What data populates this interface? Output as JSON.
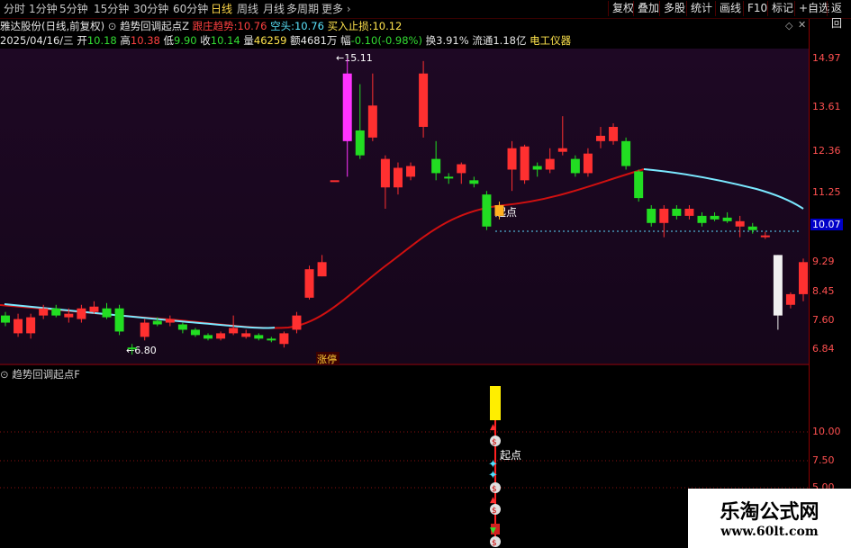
{
  "toolbar": {
    "periods": [
      "分时",
      "1分钟",
      "5分钟",
      "15分钟",
      "30分钟",
      "60分钟",
      "日线",
      "周线",
      "月线",
      "多周期",
      "更多"
    ],
    "active_period": "日线",
    "right_buttons": [
      "复权",
      "叠加",
      "多股",
      "统计",
      "画线",
      "F10",
      "标记",
      "+自选",
      "返回"
    ]
  },
  "info": {
    "stock": "雅达股份(日线,前复权)",
    "indicator_name": "趋势回调起点Z",
    "follow_label": "跟庄趋势:",
    "follow_value": "10.76",
    "bear_label": "空头:",
    "bear_value": "10.76",
    "buy_label": "买入止损:",
    "buy_value": "10.12",
    "date": "2025/04/16/三",
    "open_label": "开",
    "open": "10.18",
    "high_label": "高",
    "high": "10.38",
    "low_label": "低",
    "low": "9.90",
    "close_label": "收",
    "close": "10.14",
    "volume_label": "量",
    "volume": "46259",
    "amount_label": "额",
    "amount": "4681万",
    "change_label": "幅",
    "change": "-0.10(-0.98%)",
    "turnover_label": "换",
    "turnover": "3.91%",
    "float_label": "流通",
    "float": "1.18亿",
    "industry": "电工仪器"
  },
  "right_axis": {
    "ticks": [
      "14.97",
      "13.61",
      "12.36",
      "11.25",
      "9.29",
      "8.45",
      "7.60",
      "6.84"
    ],
    "current": "10.07",
    "sub_ticks": [
      "10.00",
      "7.50",
      "5.00"
    ]
  },
  "annotations": {
    "high_mark": "15.11",
    "low_mark": "6.80",
    "start_label": "起点",
    "limit_up_label": "涨停",
    "sub_start_label": "起点"
  },
  "lower_panel": {
    "title": "趋势回调起点F"
  },
  "watermark": {
    "title": "乐淘公式网",
    "url": "www.60lt.com"
  },
  "colors": {
    "up": "#ff3030",
    "down": "#22dd22",
    "ma_cyan": "#6ee6ff",
    "ma_red": "#dd1010",
    "highlight": "#ff33ff"
  },
  "chart_data": {
    "type": "candlestick",
    "price_range": [
      6.5,
      15.4
    ],
    "candles": [
      {
        "o": 7.9,
        "c": 7.7,
        "h": 8.0,
        "l": 7.6
      },
      {
        "o": 7.4,
        "c": 7.8,
        "h": 7.95,
        "l": 7.3
      },
      {
        "o": 7.4,
        "c": 7.85,
        "h": 7.95,
        "l": 7.25
      },
      {
        "o": 7.9,
        "c": 8.1,
        "h": 8.2,
        "l": 7.8
      },
      {
        "o": 8.1,
        "c": 7.9,
        "h": 8.2,
        "l": 7.85
      },
      {
        "o": 7.85,
        "c": 7.95,
        "h": 8.1,
        "l": 7.7
      },
      {
        "o": 7.8,
        "c": 8.1,
        "h": 8.2,
        "l": 7.7
      },
      {
        "o": 8.0,
        "c": 8.15,
        "h": 8.3,
        "l": 7.95
      },
      {
        "o": 8.1,
        "c": 7.85,
        "h": 8.25,
        "l": 7.8
      },
      {
        "o": 8.1,
        "c": 7.45,
        "h": 8.2,
        "l": 7.35
      },
      {
        "o": 7.0,
        "c": 6.95,
        "h": 7.1,
        "l": 6.8
      },
      {
        "o": 7.3,
        "c": 7.7,
        "h": 7.8,
        "l": 7.2
      },
      {
        "o": 7.75,
        "c": 7.65,
        "h": 7.85,
        "l": 7.6
      },
      {
        "o": 7.7,
        "c": 7.8,
        "h": 7.9,
        "l": 7.6
      },
      {
        "o": 7.65,
        "c": 7.5,
        "h": 7.7,
        "l": 7.4
      },
      {
        "o": 7.5,
        "c": 7.35,
        "h": 7.55,
        "l": 7.3
      },
      {
        "o": 7.35,
        "c": 7.25,
        "h": 7.4,
        "l": 7.2
      },
      {
        "o": 7.25,
        "c": 7.4,
        "h": 7.45,
        "l": 7.2
      },
      {
        "o": 7.4,
        "c": 7.55,
        "h": 7.9,
        "l": 7.35
      },
      {
        "o": 7.3,
        "c": 7.4,
        "h": 7.5,
        "l": 7.25
      },
      {
        "o": 7.35,
        "c": 7.25,
        "h": 7.4,
        "l": 7.2
      },
      {
        "o": 7.25,
        "c": 7.2,
        "h": 7.3,
        "l": 7.15
      },
      {
        "o": 7.1,
        "c": 7.4,
        "h": 7.45,
        "l": 7.0
      },
      {
        "o": 7.5,
        "c": 7.9,
        "h": 8.0,
        "l": 7.4
      },
      {
        "o": 8.4,
        "c": 9.2,
        "h": 9.3,
        "l": 8.35
      },
      {
        "o": 9.0,
        "c": 9.4,
        "h": 9.6,
        "l": 9.0
      },
      {
        "o": 11.7,
        "c": 11.7,
        "h": 11.7,
        "l": 11.7,
        "flat": true
      },
      {
        "o": 12.8,
        "c": 14.7,
        "h": 15.11,
        "l": 11.8,
        "special": true
      },
      {
        "o": 13.1,
        "c": 12.4,
        "h": 14.4,
        "l": 12.3
      },
      {
        "o": 12.9,
        "c": 13.8,
        "h": 14.7,
        "l": 12.8
      },
      {
        "o": 11.5,
        "c": 12.3,
        "h": 12.4,
        "l": 10.9
      },
      {
        "o": 11.5,
        "c": 12.05,
        "h": 12.2,
        "l": 11.3
      },
      {
        "o": 11.8,
        "c": 12.1,
        "h": 12.2,
        "l": 11.7
      },
      {
        "o": 13.2,
        "c": 14.7,
        "h": 15.05,
        "l": 12.9
      },
      {
        "o": 12.3,
        "c": 11.9,
        "h": 12.8,
        "l": 11.7
      },
      {
        "o": 11.8,
        "c": 11.75,
        "h": 11.9,
        "l": 11.6
      },
      {
        "o": 11.9,
        "c": 12.15,
        "h": 12.2,
        "l": 11.6
      },
      {
        "o": 11.7,
        "c": 11.6,
        "h": 11.8,
        "l": 11.5
      },
      {
        "o": 11.3,
        "c": 10.4,
        "h": 11.4,
        "l": 10.3
      },
      {
        "o": 11.0,
        "c": 10.7,
        "h": 11.1,
        "l": 10.6,
        "gold": true
      },
      {
        "o": 12.0,
        "c": 12.6,
        "h": 12.8,
        "l": 11.4
      },
      {
        "o": 11.7,
        "c": 12.65,
        "h": 12.7,
        "l": 11.6
      },
      {
        "o": 12.1,
        "c": 12.0,
        "h": 12.2,
        "l": 11.8
      },
      {
        "o": 12.0,
        "c": 12.3,
        "h": 12.6,
        "l": 11.9
      },
      {
        "o": 12.5,
        "c": 12.6,
        "h": 13.5,
        "l": 12.4
      },
      {
        "o": 12.3,
        "c": 11.9,
        "h": 12.4,
        "l": 11.8
      },
      {
        "o": 11.9,
        "c": 12.45,
        "h": 12.6,
        "l": 11.8
      },
      {
        "o": 12.8,
        "c": 12.95,
        "h": 13.2,
        "l": 12.6
      },
      {
        "o": 12.8,
        "c": 13.2,
        "h": 13.3,
        "l": 12.7
      },
      {
        "o": 12.8,
        "c": 12.1,
        "h": 12.9,
        "l": 12.0
      },
      {
        "o": 11.95,
        "c": 11.2,
        "h": 12.0,
        "l": 11.1
      },
      {
        "o": 10.9,
        "c": 10.5,
        "h": 11.0,
        "l": 10.4
      },
      {
        "o": 10.5,
        "c": 10.9,
        "h": 11.0,
        "l": 10.1
      },
      {
        "o": 10.9,
        "c": 10.7,
        "h": 11.0,
        "l": 10.6
      },
      {
        "o": 10.7,
        "c": 10.9,
        "h": 11.0,
        "l": 10.6
      },
      {
        "o": 10.7,
        "c": 10.5,
        "h": 10.8,
        "l": 10.4
      },
      {
        "o": 10.7,
        "c": 10.6,
        "h": 10.8,
        "l": 10.55
      },
      {
        "o": 10.65,
        "c": 10.55,
        "h": 10.8,
        "l": 10.5
      },
      {
        "o": 10.4,
        "c": 10.55,
        "h": 10.7,
        "l": 10.1
      },
      {
        "o": 10.4,
        "c": 10.3,
        "h": 10.5,
        "l": 10.2
      },
      {
        "o": 10.15,
        "c": 10.15,
        "h": 10.25,
        "l": 10.05
      },
      {
        "o": 7.9,
        "c": 9.6,
        "h": 9.6,
        "l": 7.5,
        "white": true
      },
      {
        "o": 8.2,
        "c": 8.5,
        "h": 8.55,
        "l": 8.1
      },
      {
        "o": 8.5,
        "c": 9.4,
        "h": 9.5,
        "l": 8.3
      }
    ]
  }
}
